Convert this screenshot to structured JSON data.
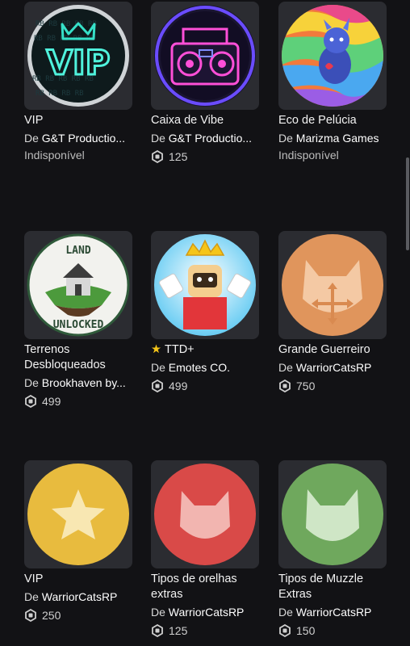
{
  "items": [
    {
      "name": "VIP",
      "by": "De",
      "creator": "G&T Productio...",
      "status": "Indisponível"
    },
    {
      "name": "Caixa de Vibe",
      "by": "De",
      "creator": "G&T Productio...",
      "price": "125"
    },
    {
      "name": "Eco de Pelúcia",
      "by": "De",
      "creator": "Marizma Games",
      "status": "Indisponível"
    },
    {
      "name": "Terrenos Desbloqueados",
      "by": "De",
      "creator": "Brookhaven by...",
      "price": "499"
    },
    {
      "name": "TTD+",
      "by": "De",
      "creator": "Emotes CO.",
      "price": "499",
      "featured": true
    },
    {
      "name": "Grande Guerreiro",
      "by": "De",
      "creator": "WarriorCatsRP",
      "price": "750"
    },
    {
      "name": "VIP",
      "by": "De",
      "creator": "WarriorCatsRP",
      "price": "250"
    },
    {
      "name": "Tipos de orelhas extras",
      "by": "De",
      "creator": "WarriorCatsRP",
      "price": "125"
    },
    {
      "name": "Tipos de Muzzle Extras",
      "by": "De",
      "creator": "WarriorCatsRP",
      "price": "150"
    }
  ],
  "icons": {
    "currency": "robux-icon",
    "featured": "star-icon"
  },
  "thumbnails": {
    "vip_sign_text": "VIP",
    "land_top_text": "LAND",
    "land_bottom_text": "UNLOCKED"
  },
  "colors": {
    "background": "#121215",
    "thumb_bg": "#2b2c31",
    "orange_badge": "#e0955c",
    "yellow_badge": "#e8bb3e",
    "red_badge": "#d94a48",
    "green_badge": "#6fa85d"
  }
}
